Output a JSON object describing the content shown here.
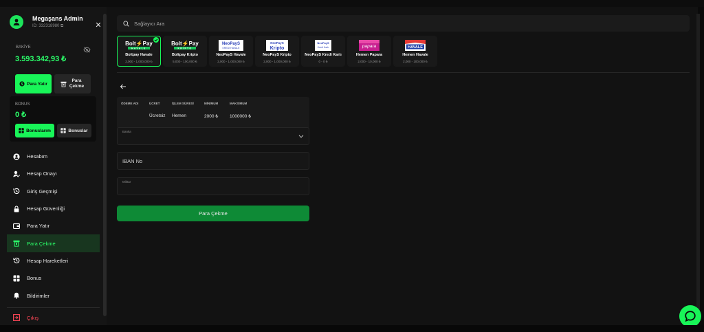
{
  "user": {
    "name": "Megaşans Admin",
    "id_label": "ID: 332318980"
  },
  "balance": {
    "label": "BAKİYE",
    "value": "3.593.342,93 ₺",
    "deposit_label": "Para Yatır",
    "withdraw_label": "Para Çekme"
  },
  "bonus": {
    "label": "BONUS",
    "value": "0 ₺",
    "my_bonuses_label": "Bonuslarım",
    "bonuses_label": "Bonuslar"
  },
  "nav": {
    "items": [
      {
        "label": "Hesabım",
        "icon": "user-circle-icon"
      },
      {
        "label": "Hesap Onayı",
        "icon": "user-check-icon"
      },
      {
        "label": "Giriş Geçmişi",
        "icon": "history-icon"
      },
      {
        "label": "Hesap Güvenliği",
        "icon": "lock-icon"
      },
      {
        "label": "Para Yatır",
        "icon": "wallet-icon"
      },
      {
        "label": "Para Çekme",
        "icon": "withdraw-icon",
        "active": true
      },
      {
        "label": "Hesap Hareketleri",
        "icon": "history-icon"
      },
      {
        "label": "Bonus",
        "icon": "gift-icon"
      },
      {
        "label": "Bildirimler",
        "icon": "bell-icon"
      }
    ],
    "logout_label": "Çıkış"
  },
  "search": {
    "placeholder": "Sağlayıcı Ara"
  },
  "methods": [
    {
      "logo": "Bolt Pay HAVALE",
      "name": "Boltpay Havale",
      "range": "2,000 - 1,000,000 ₺",
      "selected": true
    },
    {
      "logo": "Bolt Pay KRIPTO",
      "name": "Boltpay Kripto",
      "range": "5,000 - 100,000 ₺"
    },
    {
      "logo": "NeoPayS KREDI HAVALE",
      "name": "NeoPayS Havale",
      "range": "2,000 - 1,000,000 ₺"
    },
    {
      "logo": "NeoPayS Kripto",
      "name": "NeoPayS Kripto",
      "range": "2,000 - 1,000,000 ₺"
    },
    {
      "logo": "NeoPayS Kredi Kartı",
      "name": "NeoPayS Kredi Kartı",
      "range": "0 - 0 ₺"
    },
    {
      "logo": "papara",
      "name": "Hemen Papara",
      "range": "2,000 - 10,000 ₺"
    },
    {
      "logo": "HAVALE",
      "name": "Hemen Havale",
      "range": "2,000 - 100,000 ₺"
    }
  ],
  "table": {
    "headers": [
      "ÖDEME ADI",
      "ÜCRET",
      "İŞLEM SÜRESİ",
      "MİNİMUM",
      "MAKSİMUM"
    ],
    "row": [
      "",
      "Ücretsiz",
      "Hemen",
      "2000 ₺",
      "1000000 ₺"
    ]
  },
  "form": {
    "bank_label": "Banka",
    "bank_value": "",
    "iban_placeholder": "IBAN No",
    "amount_label": "Miktar",
    "submit_label": "Para Çekme"
  },
  "colors": {
    "accent": "#18f558",
    "sidebar": "#151515",
    "main": "#121212",
    "submit": "#0e8a36",
    "danger": "#ff4757"
  }
}
